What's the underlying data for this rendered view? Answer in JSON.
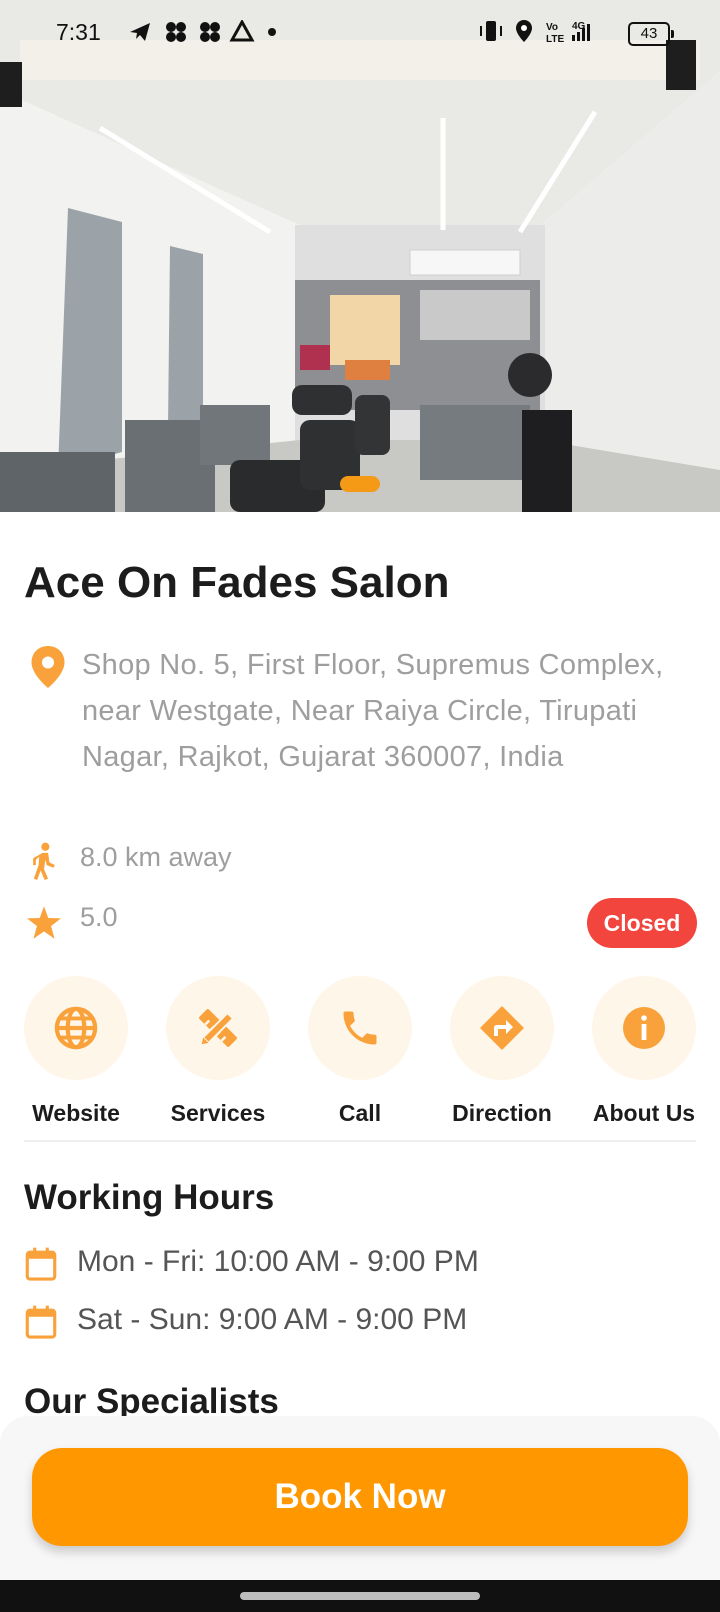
{
  "status_bar": {
    "time": "7:31",
    "left_icons": [
      "telegram-icon",
      "pinwheel-icon",
      "pinwheel-icon",
      "drive-icon",
      "dot-icon"
    ],
    "right_icons": [
      "vibrate-icon",
      "location-icon",
      "volte-icon",
      "signal-4g-icon"
    ],
    "volte_label": "Vo LTE",
    "network_label": "4G",
    "battery": "43"
  },
  "hero": {
    "image_description": "salon interior photo",
    "page_indicator_active": 1
  },
  "salon": {
    "name": "Ace On Fades Salon",
    "address": "Shop No. 5, First Floor, Supremus Complex, near Westgate, Near Raiya Circle, Tirupati Nagar, Rajkot, Gujarat 360007, India",
    "distance": "8.0 km away",
    "rating": "5.0",
    "status": "Closed"
  },
  "actions": [
    {
      "label": "Website",
      "icon": "globe-icon"
    },
    {
      "label": "Services",
      "icon": "tools-icon"
    },
    {
      "label": "Call",
      "icon": "phone-icon"
    },
    {
      "label": "Direction",
      "icon": "direction-icon"
    },
    {
      "label": "About Us",
      "icon": "info-icon"
    }
  ],
  "working_hours": {
    "title": "Working Hours",
    "rows": [
      "Mon - Fri: 10:00 AM - 9:00 PM",
      "Sat - Sun: 9:00 AM - 9:00 PM"
    ]
  },
  "specialists": {
    "title": "Our Specialists"
  },
  "book_button": {
    "label": "Book Now"
  },
  "colors": {
    "accent": "#ff9800",
    "icon_orange": "#f9a23b",
    "closed_red": "#f1453d",
    "muted_text": "#9e9e9e"
  }
}
